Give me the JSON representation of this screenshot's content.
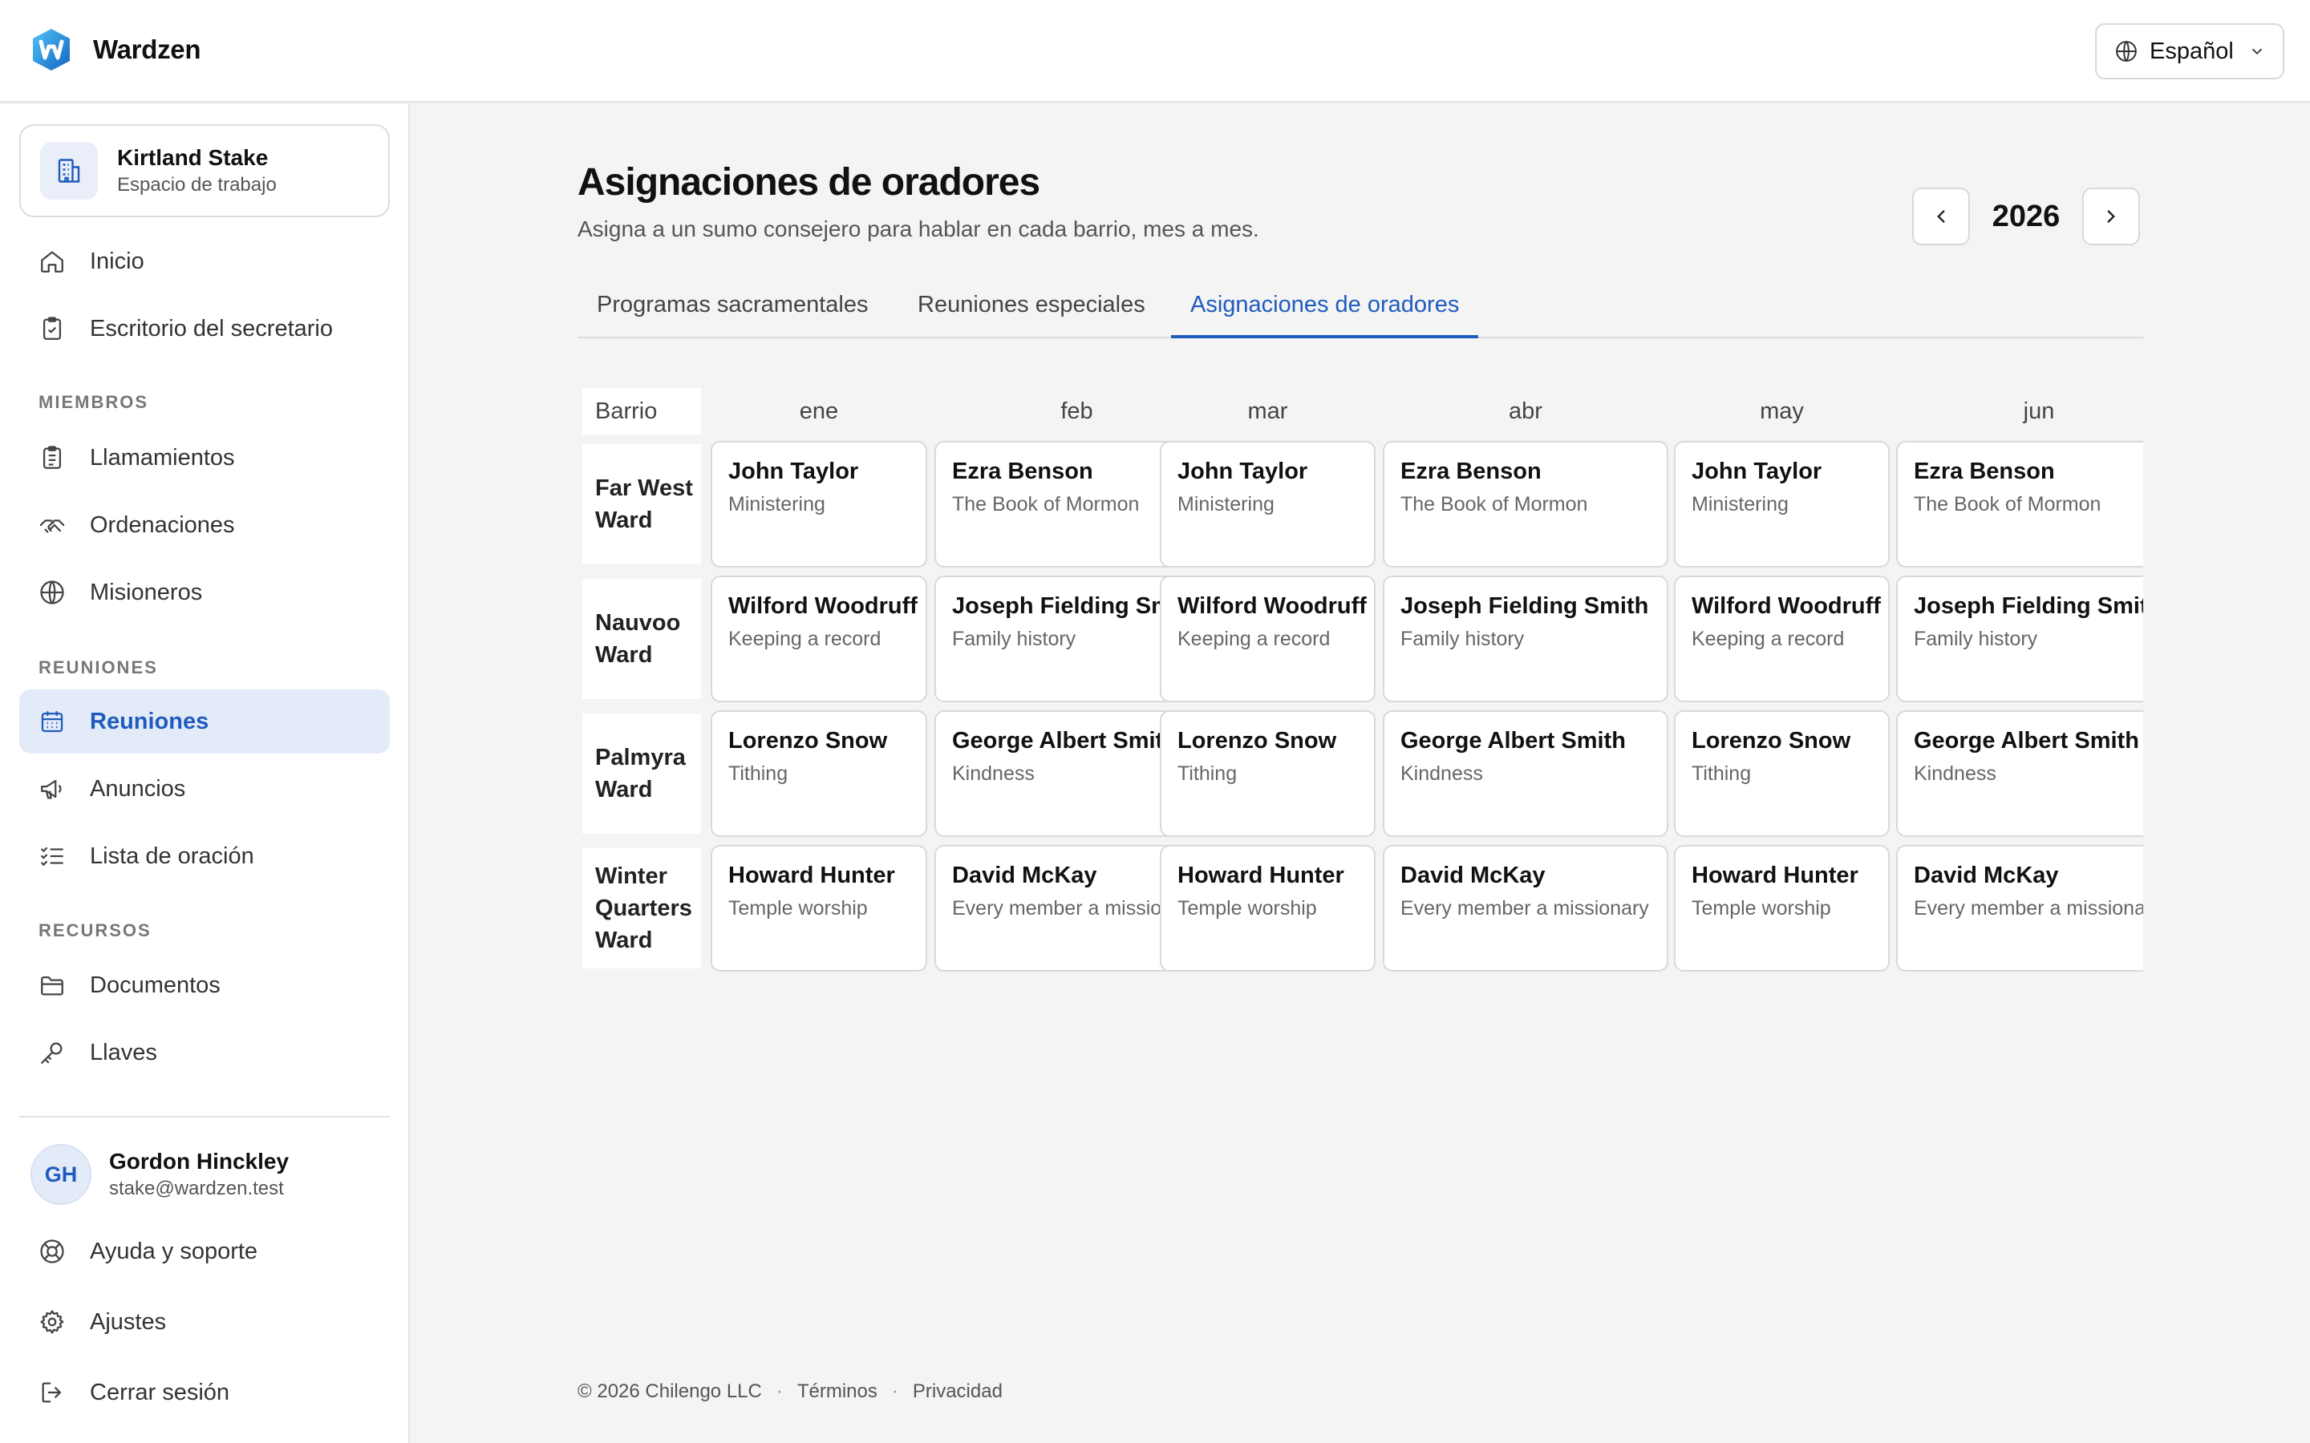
{
  "app": {
    "name": "Wardzen"
  },
  "language": {
    "selected": "Español"
  },
  "workspace": {
    "name": "Kirtland Stake",
    "subtitle": "Espacio de trabajo"
  },
  "nav": {
    "top": [
      {
        "label": "Inicio",
        "icon": "home-icon"
      },
      {
        "label": "Escritorio del secretario",
        "icon": "clipboard-check-icon"
      }
    ],
    "sections": {
      "miembros": "MIEMBROS",
      "reuniones": "REUNIONES",
      "recursos": "RECURSOS"
    },
    "miembros": [
      {
        "label": "Llamamientos",
        "icon": "clipboard-list-icon"
      },
      {
        "label": "Ordenaciones",
        "icon": "handshake-icon"
      },
      {
        "label": "Misioneros",
        "icon": "globe-icon"
      }
    ],
    "reuniones": [
      {
        "label": "Reuniones",
        "icon": "calendar-icon",
        "active": true
      },
      {
        "label": "Anuncios",
        "icon": "megaphone-icon"
      },
      {
        "label": "Lista de oración",
        "icon": "checklist-icon"
      }
    ],
    "recursos": [
      {
        "label": "Documentos",
        "icon": "folder-icon"
      },
      {
        "label": "Llaves",
        "icon": "key-icon"
      }
    ]
  },
  "user": {
    "initials": "GH",
    "name": "Gordon Hinckley",
    "email": "stake@wardzen.test"
  },
  "bottom_nav": [
    {
      "label": "Ayuda y soporte",
      "icon": "lifebuoy-icon"
    },
    {
      "label": "Ajustes",
      "icon": "gear-icon"
    },
    {
      "label": "Cerrar sesión",
      "icon": "logout-icon"
    }
  ],
  "page": {
    "title": "Asignaciones de oradores",
    "subtitle": "Asigna a un sumo consejero para hablar en cada barrio, mes a mes.",
    "year": "2026"
  },
  "tabs": [
    {
      "label": "Programas sacramentales",
      "active": false
    },
    {
      "label": "Reuniones especiales",
      "active": false
    },
    {
      "label": "Asignaciones de oradores",
      "active": true
    }
  ],
  "grid": {
    "corner_label": "Barrio",
    "months": [
      "ene",
      "feb",
      "mar",
      "abr",
      "may",
      "jun"
    ],
    "wards": [
      {
        "name": "Far West Ward",
        "cells": [
          {
            "speaker": "John Taylor",
            "topic": "Ministering"
          },
          {
            "speaker": "Ezra Benson",
            "topic": "The Book of Mormon"
          },
          {
            "speaker": "John Taylor",
            "topic": "Ministering"
          },
          {
            "speaker": "Ezra Benson",
            "topic": "The Book of Mormon"
          },
          {
            "speaker": "John Taylor",
            "topic": "Ministering"
          },
          {
            "speaker": "Ezra Benson",
            "topic": "The Book of Mormon"
          }
        ]
      },
      {
        "name": "Nauvoo Ward",
        "cells": [
          {
            "speaker": "Wilford Woodruff",
            "topic": "Keeping a record"
          },
          {
            "speaker": "Joseph Fielding Smith",
            "topic": "Family history"
          },
          {
            "speaker": "Wilford Woodruff",
            "topic": "Keeping a record"
          },
          {
            "speaker": "Joseph Fielding Smith",
            "topic": "Family history"
          },
          {
            "speaker": "Wilford Woodruff",
            "topic": "Keeping a record"
          },
          {
            "speaker": "Joseph Fielding Smith",
            "topic": "Family history"
          }
        ]
      },
      {
        "name": "Palmyra Ward",
        "cells": [
          {
            "speaker": "Lorenzo Snow",
            "topic": "Tithing"
          },
          {
            "speaker": "George Albert Smith",
            "topic": "Kindness"
          },
          {
            "speaker": "Lorenzo Snow",
            "topic": "Tithing"
          },
          {
            "speaker": "George Albert Smith",
            "topic": "Kindness"
          },
          {
            "speaker": "Lorenzo Snow",
            "topic": "Tithing"
          },
          {
            "speaker": "George Albert Smith",
            "topic": "Kindness"
          }
        ]
      },
      {
        "name": "Winter Quarters Ward",
        "cells": [
          {
            "speaker": "Howard Hunter",
            "topic": "Temple worship"
          },
          {
            "speaker": "David McKay",
            "topic": "Every member a missionary"
          },
          {
            "speaker": "Howard Hunter",
            "topic": "Temple worship"
          },
          {
            "speaker": "David McKay",
            "topic": "Every member a missionary"
          },
          {
            "speaker": "Howard Hunter",
            "topic": "Temple worship"
          },
          {
            "speaker": "David McKay",
            "topic": "Every member a missionary"
          }
        ]
      }
    ]
  },
  "footer": {
    "copyright": "© 2026 Chilengo LLC",
    "terms": "Términos",
    "privacy": "Privacidad"
  },
  "colors": {
    "accent": "#1f5bbf",
    "active_bg": "#e4ebf8",
    "logo": "#1e88e5"
  }
}
